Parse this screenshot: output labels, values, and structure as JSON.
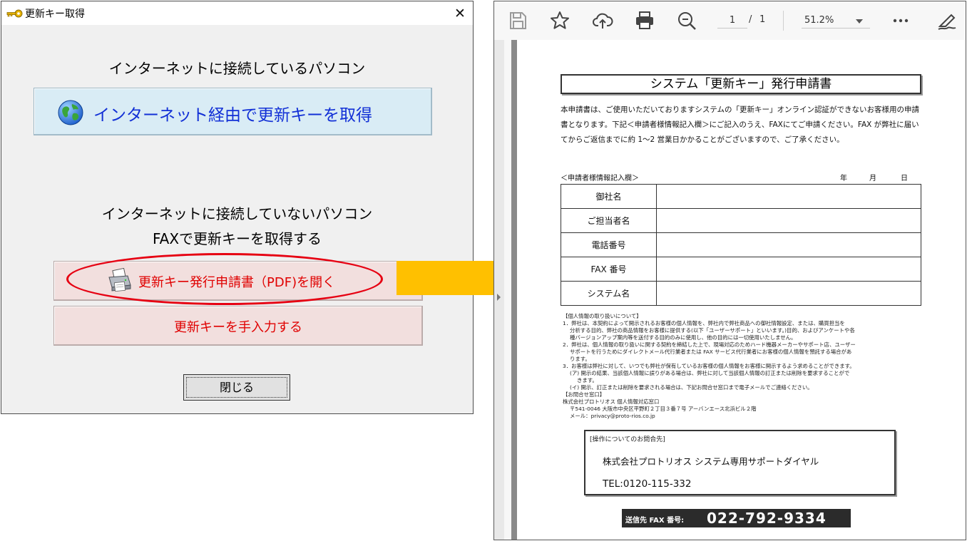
{
  "dialog": {
    "title": "更新キー取得",
    "close_glyph": "✕",
    "online_heading": "インターネットに接続しているパソコン",
    "online_button": "インターネット経由で更新キーを取得",
    "offline_heading_1": "インターネットに接続していないパソコン",
    "offline_heading_2": "FAXで更新キーを取得する",
    "pdf_button": "更新キー発行申請書（PDF)を開く",
    "manual_button": "更新キーを手入力する",
    "close_button": "閉じる"
  },
  "viewer": {
    "page_current": "1",
    "page_separator": "/",
    "page_total": "1",
    "zoom": "51.2%",
    "toolbar_icons": [
      "save-icon",
      "star-icon",
      "upload-icon",
      "print-icon",
      "zoom-out-icon",
      "more-icon",
      "sign-icon"
    ]
  },
  "document": {
    "title": "システム「更新キー」発行申請書",
    "intro": "本申請書は、ご使用いただいておりますシステムの「更新キー」オンライン認証ができないお客様用の申請書となります。下記＜申請者様情報記入欄＞にご記入のうえ、FAXにてご申請ください。FAX が弊社に届いてからご返信までに約 1～2 営業日かかることがございますので、ご了承ください。",
    "form_heading": "＜申請者様情報記入欄＞",
    "date_year": "年",
    "date_month": "月",
    "date_day": "日",
    "form_rows": [
      {
        "label": "御社名"
      },
      {
        "label": "ご担当者名"
      },
      {
        "label": "電話番号"
      },
      {
        "label": "FAX 番号"
      },
      {
        "label": "システム名"
      }
    ],
    "privacy_lines": [
      "【個人情報の取り扱いについて】",
      "1．弊社は、本契約によって開示されるお客様の個人情報を、弊社内で弊社商品への御社情報設定、または、購買担当を",
      "分析する目的、弊社の商品情報をお客様に提供する(以下「ユーザーサポート」といいます。)目的、およびアンケートや各",
      "種バージョンアップ案内等を送付する目的のみに使用し、他の目的には一切使用いたしません。",
      "2．弊社は、個人情報の取り扱いに関する契約を締結した上で、現場対応のためハード機器メーカーやサポート店、ユーザー",
      "サポートを行うためにダイレクトメール代行業者または FAX サービス代行業者にお客様の個人情報を預託する場合があ",
      "ります。",
      "3．お客様は弊社に対して、いつでも弊社が保有しているお客様の個人情報をお客様に開示するよう求めることができます。",
      "(ア) 開示の結果、当該個人情報に誤りがある場合は、弊社に対して当該個人情報の訂正または削除を要求することがで",
      "きます。",
      "(イ) 開示、訂正または削除を要求される場合は、下記お問合せ窓口まで電子メールでご連絡ください。",
      "【お問合せ窓口】",
      "株式会社プロトリオス 個人情報対応窓口",
      "〒541-0046 大阪市中央区平野町２丁目３番７号 アーバンエース北浜ビル２階",
      "メール：privacy@proto-rios.co.jp"
    ],
    "support_heading": "[操作についてのお問合先]",
    "support_name": "株式会社プロトリオス  システム専用サポートダイヤル",
    "support_tel": "TEL:0120-115-332",
    "fax_label": "送信先 FAX 番号:",
    "fax_number": "022-792-9334"
  },
  "colors": {
    "highlight_oval": "#e60012",
    "arrow": "#ffc000",
    "online_button_bg": "#d9ecf5",
    "online_button_text": "#1230d6",
    "fax_button_bg": "#f2dfde",
    "fax_button_text": "#e00000"
  }
}
